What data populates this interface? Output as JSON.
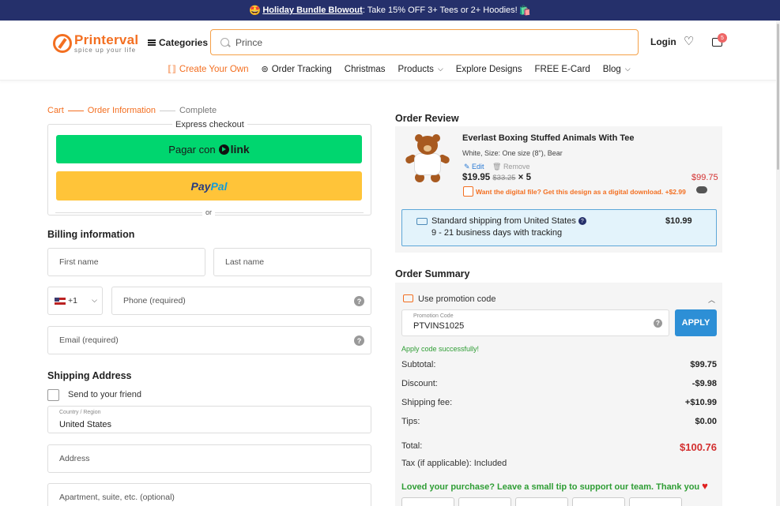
{
  "promo_bar": {
    "emoji_left": "🤩",
    "link_text": "Holiday Bundle Blowout",
    "text": ": Take 15% OFF 3+ Tees or 2+ Hoodies!",
    "emoji_right": "🛍️"
  },
  "header": {
    "logo_name": "Printerval",
    "logo_tagline": "spice up your life",
    "categories_label": "Categories",
    "search_value": "Prince",
    "login_label": "Login",
    "cart_count": "5"
  },
  "nav": {
    "items": [
      {
        "label": "Create Your Own"
      },
      {
        "label": "Order Tracking"
      },
      {
        "label": "Christmas"
      },
      {
        "label": "Products"
      },
      {
        "label": "Explore Designs"
      },
      {
        "label": "FREE E-Card"
      },
      {
        "label": "Blog"
      }
    ]
  },
  "steps": [
    "Cart",
    "Order Information",
    "Complete"
  ],
  "express": {
    "title": "Express checkout",
    "link_prefix": "Pagar con",
    "link_word": "link",
    "paypal_a": "Pay",
    "paypal_b": "Pal",
    "or": "or"
  },
  "billing": {
    "title": "Billing information",
    "first_name": "First name",
    "last_name": "Last name",
    "country_code": "+1",
    "phone": "Phone (required)",
    "email": "Email (required)"
  },
  "shipping": {
    "title": "Shipping Address",
    "send_friend": "Send to your friend",
    "country_label": "Country / Region",
    "country_value": "United States",
    "address": "Address",
    "apartment": "Apartment, suite, etc. (optional)"
  },
  "order_review": {
    "title": "Order Review",
    "product_name": "Everlast Boxing Stuffed Animals With Tee",
    "variant": "White, Size: One size (8\"), Bear",
    "edit": "Edit",
    "remove": "Remove",
    "price": "$19.95",
    "old_price": "$33.25",
    "qty": "× 5",
    "line_total": "$99.75",
    "digital_offer": "Want the digital file? Get this design as a digital download. +$2.99",
    "shipping_method": "Standard shipping from United States",
    "shipping_time": "9 - 21 business days with tracking",
    "shipping_price": "$10.99"
  },
  "order_summary": {
    "title": "Order Summary",
    "promo_toggle": "Use promotion code",
    "promo_label": "Promotion Code",
    "promo_value": "PTVINS1025",
    "apply": "APPLY",
    "success": "Apply code successfully!",
    "rows": [
      {
        "label": "Subtotal:",
        "value": "$99.75"
      },
      {
        "label": "Discount:",
        "value": "-$9.98"
      },
      {
        "label": "Shipping fee:",
        "value": "+$10.99"
      },
      {
        "label": "Tips:",
        "value": "$0.00"
      }
    ],
    "total_label": "Total:",
    "total_value": "$100.76",
    "tax": "Tax (if applicable): Included",
    "tip_message": "Loved your purchase? Leave a small tip to support our team. Thank you"
  }
}
